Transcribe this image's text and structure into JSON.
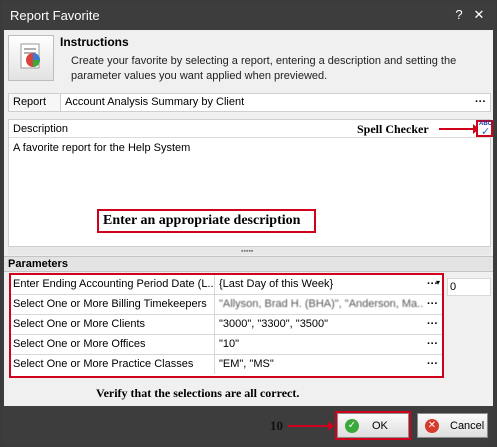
{
  "window": {
    "title": "Report Favorite",
    "help_glyph": "?",
    "close_glyph": "✕"
  },
  "instructions": {
    "title": "Instructions",
    "text": "Create your favorite by selecting a report, entering a description and setting the parameter values you want applied when previewed.",
    "icon": "report-favorite-icon"
  },
  "report": {
    "label": "Report",
    "value": "Account Analysis Summary by Client",
    "button": "···"
  },
  "description": {
    "label": "Description",
    "value": "A favorite report for the Help System",
    "spell_checker_label": "Spell Checker",
    "spell_icon_text": "ABC",
    "spell_tick": "✓",
    "annotation": "Enter an appropriate description"
  },
  "splitter": {
    "grip": "▪▪▪▪▪"
  },
  "parameters": {
    "header": "Parameters",
    "rows": [
      {
        "name": "Enter Ending Accounting Period Date (L...",
        "value": "{Last Day of this Week}",
        "button": "···",
        "dropdown": "▾"
      },
      {
        "name": "Select One or More Billing Timekeepers",
        "value": "\"Allyson, Brad H. (BHA)\", \"Anderson, Ma...",
        "button": "···"
      },
      {
        "name": "Select One or More Clients",
        "value": "\"3000\", \"3300\", \"3500\"",
        "button": "···"
      },
      {
        "name": "Select One or More Offices",
        "value": "\"10\"",
        "button": "···"
      },
      {
        "name": "Select One or More Practice Classes",
        "value": "\"EM\", \"MS\"",
        "button": "···"
      }
    ],
    "outside_value": "0",
    "annotation": "Verify that the selections are all correct."
  },
  "footer": {
    "step_number": "10",
    "ok_label": "OK",
    "ok_icon": "✓",
    "cancel_label": "Cancel",
    "cancel_icon": "✕"
  },
  "colors": {
    "annotation_red": "#d0021b",
    "titlebar": "#3d3d3d",
    "client_bg": "#f0f0f0"
  }
}
